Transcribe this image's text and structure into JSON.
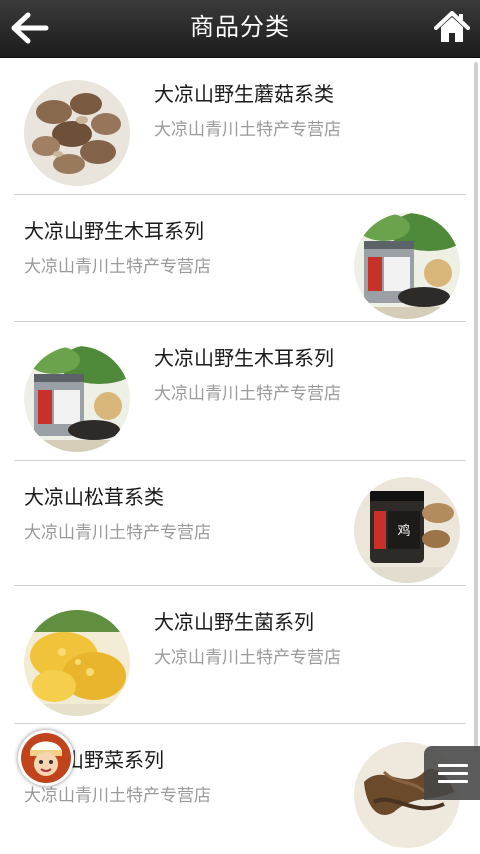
{
  "header": {
    "title": "商品分类",
    "back_icon": "back-arrow-icon",
    "home_icon": "home-icon"
  },
  "items": [
    {
      "name": "大凉山野生蘑菇系类",
      "shop": "大凉山青川土特产专营店",
      "image": "mushroom-photo"
    },
    {
      "name": "大凉山野生木耳系列",
      "shop": "大凉山青川土特产专营店",
      "image": "black-fungus-jar-photo"
    },
    {
      "name": "大凉山野生木耳系列",
      "shop": "大凉山青川土特产专营店",
      "image": "black-fungus-jar-photo"
    },
    {
      "name": "大凉山松茸系类",
      "shop": "大凉山青川土特产专营店",
      "image": "matsutake-jar-photo"
    },
    {
      "name": "大凉山野生菌系列",
      "shop": "大凉山青川土特产专营店",
      "image": "yellow-fungus-photo"
    },
    {
      "name": "大凉山野菜系列",
      "shop": "大凉山青川土特产专营店",
      "image": "wild-vegetable-photo"
    }
  ],
  "floating": {
    "avatar_icon": "cartoon-chef-avatar-icon",
    "menu_icon": "hamburger-menu-icon"
  }
}
